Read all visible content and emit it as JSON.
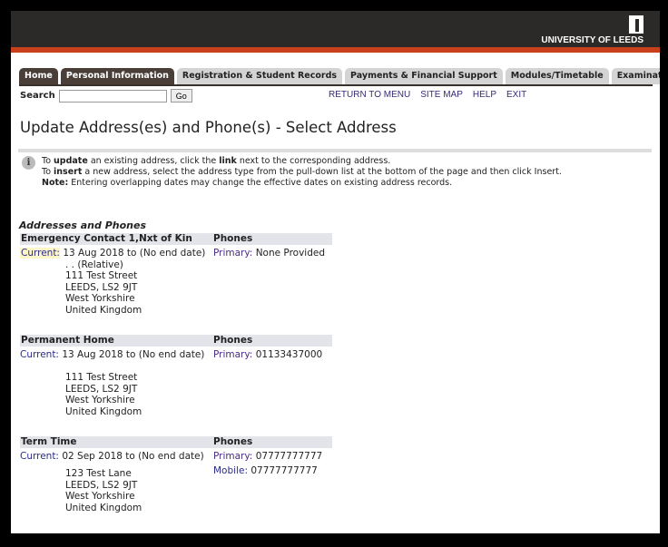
{
  "header": {
    "logo_text": "UNIVERSITY OF LEEDS"
  },
  "tabs": [
    {
      "label": "Home"
    },
    {
      "label": "Personal Information"
    },
    {
      "label": "Registration & Student Records"
    },
    {
      "label": "Payments & Financial Support"
    },
    {
      "label": "Modules/Timetable"
    },
    {
      "label": "Examinations"
    }
  ],
  "search": {
    "label": "Search",
    "value": "",
    "button": "Go"
  },
  "links": [
    "RETURN TO MENU",
    "SITE MAP",
    "HELP",
    "EXIT"
  ],
  "title": "Update Address(es) and Phone(s) - Select Address",
  "info": {
    "line1": [
      "To ",
      "update",
      " an existing address, click the ",
      "link",
      " next to the corresponding address."
    ],
    "line2": [
      "To ",
      "insert",
      " a new address, select the address type from the pull-down list at the bottom of the page and then click Insert."
    ],
    "line3": [
      "Note:",
      " Entering overlapping dates may change the effective dates on existing address records."
    ]
  },
  "section_title": "Addresses and Phones",
  "addresses": [
    {
      "type": "Emergency Contact 1,Nxt of Kin",
      "phones_header": "Phones",
      "status": "Current:",
      "dates": "13 Aug 2018 to (No end date)",
      "phones": [
        {
          "type": "Primary:",
          "value": "None Provided"
        }
      ],
      "lines": [
        ". . (Relative)",
        "111 Test Street",
        "LEEDS, LS2 9JT",
        "West Yorkshire",
        "United Kingdom"
      ]
    },
    {
      "type": "Permanent Home",
      "phones_header": "Phones",
      "status": "Current:",
      "dates": "13 Aug 2018 to (No end date)",
      "phones": [
        {
          "type": "Primary:",
          "value": "01133437000"
        }
      ],
      "lines": [
        "",
        "111 Test Street",
        "LEEDS, LS2 9JT",
        "West Yorkshire",
        "United Kingdom"
      ]
    },
    {
      "type": "Term Time",
      "phones_header": "Phones",
      "status": "Current:",
      "dates": "02 Sep 2018 to (No end date)",
      "phones": [
        {
          "type": "Primary:",
          "value": "07777777777"
        },
        {
          "type": "Mobile:",
          "value": "07777777777"
        }
      ],
      "lines": [
        "123 Test Lane",
        "LEEDS, LS2 9JT",
        "West Yorkshire",
        "United Kingdom"
      ]
    }
  ]
}
